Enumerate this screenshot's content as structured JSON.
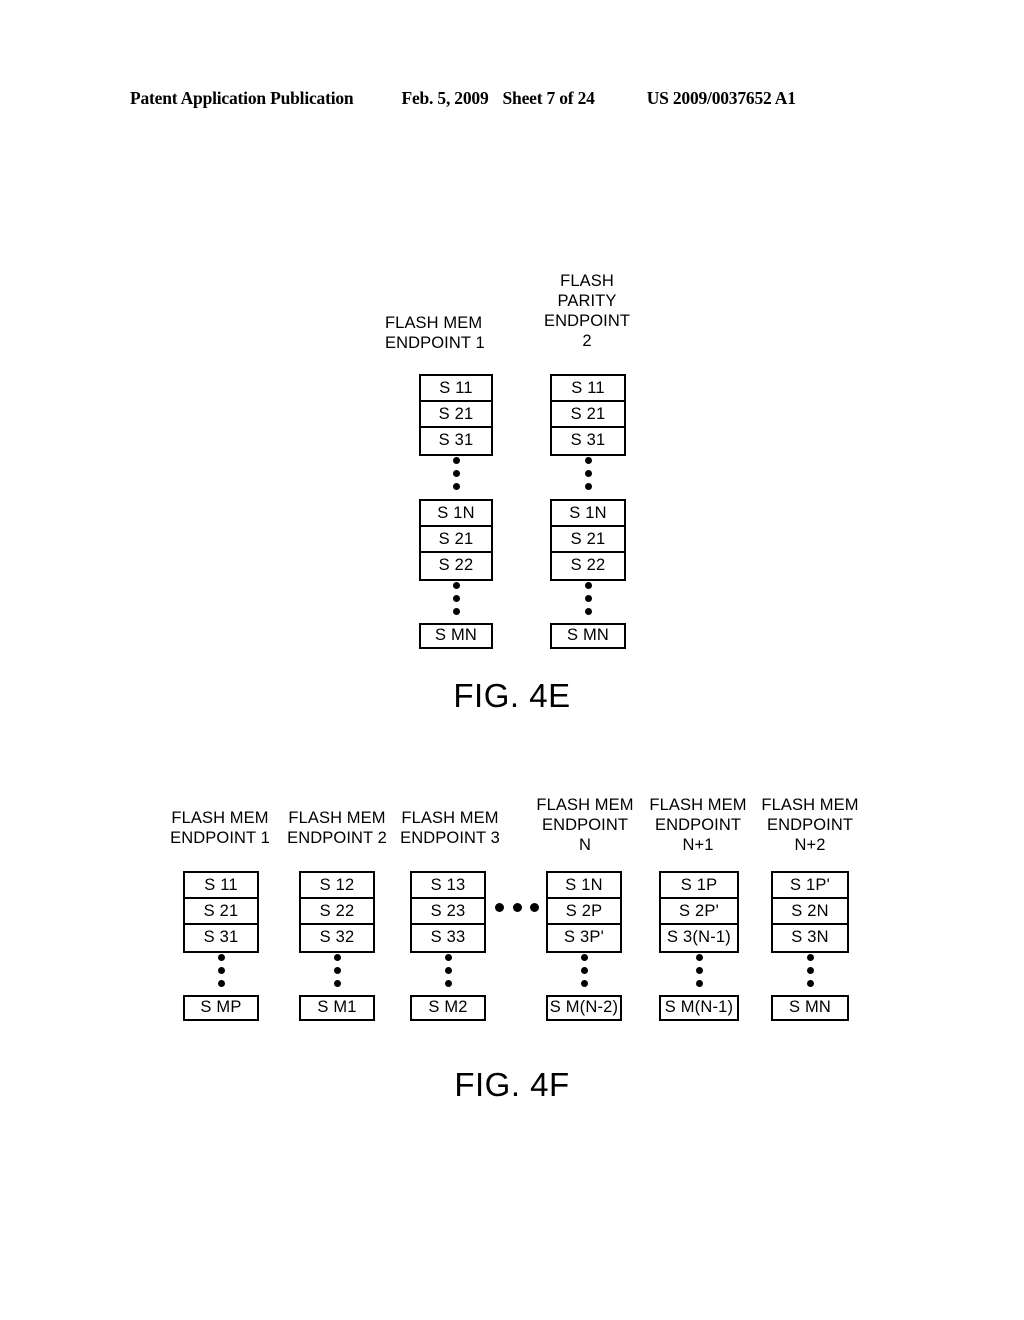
{
  "header": {
    "publication": "Patent Application Publication",
    "date": "Feb. 5, 2009",
    "sheet": "Sheet 7 of 24",
    "number": "US 2009/0037652 A1"
  },
  "figures": [
    {
      "id": "fig-4e",
      "caption": "FIG. 4E",
      "columns": [
        {
          "label": "FLASH MEM\nENDPOINT 1",
          "groups": [
            {
              "cells": [
                "S  11",
                "S  21",
                "S  31"
              ]
            },
            {
              "cells": [
                "S  1N",
                "S  21",
                "S  22"
              ]
            },
            {
              "cells": [
                "S  MN"
              ]
            }
          ]
        },
        {
          "label": "FLASH\nPARITY\nENDPOINT\n2",
          "groups": [
            {
              "cells": [
                "S  11",
                "S  21",
                "S  31"
              ]
            },
            {
              "cells": [
                "S  1N",
                "S  21",
                "S  22"
              ]
            },
            {
              "cells": [
                "S  MN"
              ]
            }
          ]
        }
      ]
    },
    {
      "id": "fig-4f",
      "caption": "FIG. 4F",
      "columns": [
        {
          "label": "FLASH MEM\nENDPOINT 1",
          "groups": [
            {
              "cells": [
                "S  11",
                "S  21",
                "S  31"
              ]
            },
            {
              "cells": [
                "S  MP"
              ]
            }
          ]
        },
        {
          "label": "FLASH MEM\nENDPOINT 2",
          "groups": [
            {
              "cells": [
                "S  12",
                "S  22",
                "S  32"
              ]
            },
            {
              "cells": [
                "S  M1"
              ]
            }
          ]
        },
        {
          "label": "FLASH MEM\nENDPOINT 3",
          "groups": [
            {
              "cells": [
                "S  13",
                "S  23",
                "S  33"
              ]
            },
            {
              "cells": [
                "S  M2"
              ]
            }
          ]
        },
        {
          "label": "FLASH MEM\nENDPOINT\nN",
          "groups": [
            {
              "cells": [
                "S  1N",
                "S  2P",
                "S  3P'"
              ]
            },
            {
              "cells": [
                "S  M(N-2)"
              ]
            }
          ]
        },
        {
          "label": "FLASH MEM\nENDPOINT\nN+1",
          "groups": [
            {
              "cells": [
                "S  1P",
                "S  2P'",
                "S  3(N-1)"
              ]
            },
            {
              "cells": [
                "S  M(N-1)"
              ]
            }
          ]
        },
        {
          "label": "FLASH MEM\nENDPOINT\nN+2",
          "groups": [
            {
              "cells": [
                "S  1P'",
                "S  2N",
                "S  3N"
              ]
            },
            {
              "cells": [
                "S  MN"
              ]
            }
          ]
        }
      ],
      "ellipsis_between_columns": "•••"
    }
  ]
}
